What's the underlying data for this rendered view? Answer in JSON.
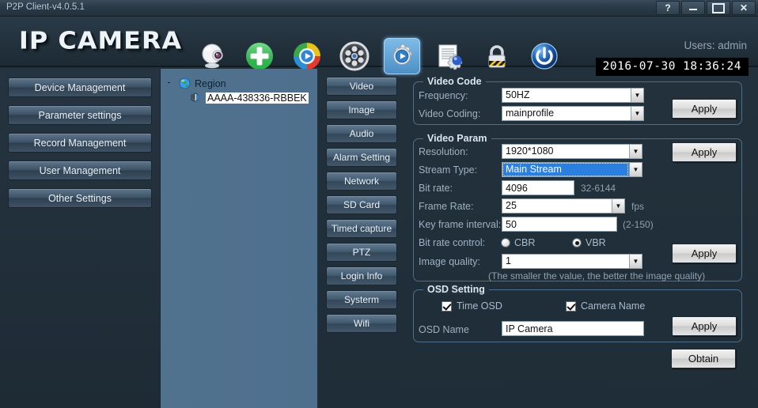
{
  "window": {
    "title": "P2P Client-v4.0.5.1",
    "buttons": [
      {
        "name": "help-button",
        "label": "?"
      },
      {
        "name": "minimize-button",
        "label": ""
      },
      {
        "name": "maximize-button",
        "label": ""
      },
      {
        "name": "close-button",
        "label": "✕"
      }
    ]
  },
  "header": {
    "logo": "IP CAMERA",
    "users": "Users: admin",
    "datetime": "2016-07-30  18:36:24",
    "toolbar": [
      {
        "name": "camera-icon",
        "label": "camera",
        "selected": false
      },
      {
        "name": "add-device-icon",
        "label": "add",
        "selected": false
      },
      {
        "name": "play-icon",
        "label": "play",
        "selected": false
      },
      {
        "name": "film-reel-icon",
        "label": "record",
        "selected": false
      },
      {
        "name": "gear-settings-icon",
        "label": "settings",
        "selected": true
      },
      {
        "name": "log-gear-icon",
        "label": "log",
        "selected": false
      },
      {
        "name": "lock-icon",
        "label": "lock",
        "selected": false
      },
      {
        "name": "power-icon",
        "label": "power",
        "selected": false
      }
    ]
  },
  "sidebar": {
    "items": [
      {
        "label": "Device Management",
        "name": "sidebar-item-device-management"
      },
      {
        "label": "Parameter settings",
        "name": "sidebar-item-parameter-settings"
      },
      {
        "label": "Record Management",
        "name": "sidebar-item-record-management"
      },
      {
        "label": "User Management",
        "name": "sidebar-item-user-management"
      },
      {
        "label": "Other Settings",
        "name": "sidebar-item-other-settings"
      }
    ]
  },
  "tree": {
    "root": {
      "label": "Region",
      "expander": "-"
    },
    "child": {
      "label": "AAAA-438336-RBBEK",
      "selected": true
    }
  },
  "tabs": [
    {
      "label": "Video"
    },
    {
      "label": "Image"
    },
    {
      "label": "Audio"
    },
    {
      "label": "Alarm Setting"
    },
    {
      "label": "Network"
    },
    {
      "label": "SD Card"
    },
    {
      "label": "Timed capture"
    },
    {
      "label": "PTZ"
    },
    {
      "label": "Login Info"
    },
    {
      "label": "Systerm"
    },
    {
      "label": "Wifi"
    }
  ],
  "video_code": {
    "legend": "Video Code",
    "frequency_label": "Frequency:",
    "frequency_value": "50HZ",
    "coding_label": "Video Coding:",
    "coding_value": "mainprofile",
    "apply_label": "Apply"
  },
  "video_param": {
    "legend": "Video Param",
    "resolution_label": "Resolution:",
    "resolution_value": "1920*1080",
    "stream_type_label": "Stream Type:",
    "stream_type_value": "Main Stream",
    "bitrate_label": "Bit rate:",
    "bitrate_value": "4096",
    "bitrate_range": "32-6144",
    "framerate_label": "Frame Rate:",
    "framerate_value": "25",
    "framerate_unit": "fps",
    "keyframe_label": "Key frame interval:",
    "keyframe_value": "50",
    "keyframe_range": "(2-150)",
    "bitrate_control_label": "Bit rate control:",
    "cbr_label": "CBR",
    "vbr_label": "VBR",
    "bitrate_control_selected": "VBR",
    "quality_label": "Image quality:",
    "quality_value": "1",
    "quality_hint": "(The smaller the value, the better the image quality)",
    "apply_top_label": "Apply",
    "apply_bottom_label": "Apply"
  },
  "osd": {
    "legend": "OSD Setting",
    "time_osd_label": "Time OSD",
    "time_osd_checked": true,
    "camera_name_label": "Camera Name",
    "camera_name_checked": true,
    "osd_name_label": "OSD Name",
    "osd_name_value": "IP Camera",
    "apply_label": "Apply"
  },
  "footer": {
    "obtain_label": "Obtain"
  }
}
